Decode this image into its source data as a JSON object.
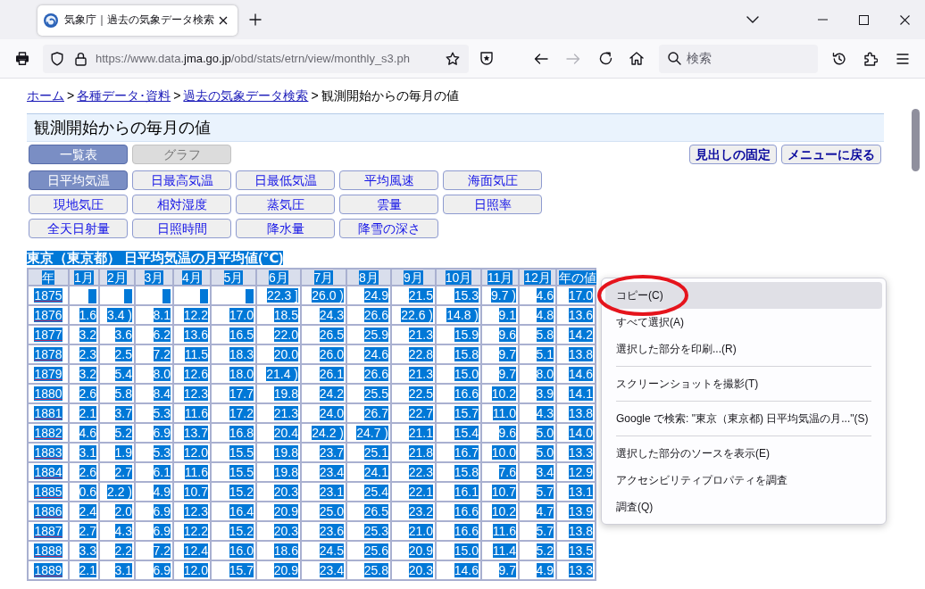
{
  "browser": {
    "tabs": [
      {
        "title": "気象庁｜過去の気象データ検索",
        "selected": true
      }
    ],
    "address": {
      "host_prefix": "https://www.data.",
      "domain": "jma.go.jp",
      "path": "/obd/stats/etrn/view/monthly_s3.ph"
    },
    "navigation": [
      {
        "kind": "back",
        "disabled": false
      },
      {
        "kind": "forward",
        "disabled": true
      }
    ],
    "search": {
      "placeholder": "検索"
    }
  },
  "breadcrumb": [
    {
      "kind": "link",
      "text": "ホーム"
    },
    {
      "kind": "separator",
      "text": ">"
    },
    {
      "kind": "link",
      "text": "各種データ･資料"
    },
    {
      "kind": "separator",
      "text": ">"
    },
    {
      "kind": "link",
      "text": "過去の気象データ検索"
    },
    {
      "kind": "separator",
      "text": ">"
    },
    {
      "kind": "current",
      "text": "観測開始からの毎月の値"
    }
  ],
  "page_title": "観測開始からの毎月の値",
  "view_buttons": [
    {
      "label": "一覧表",
      "selected": true,
      "disabled": false
    },
    {
      "label": "グラフ",
      "selected": false,
      "disabled": true
    }
  ],
  "action_buttons": [
    "見出しの固定",
    "メニューに戻る"
  ],
  "element_buttons": [
    {
      "label": "日平均気温",
      "selected": true
    },
    {
      "label": "日最高気温",
      "selected": false
    },
    {
      "label": "日最低気温",
      "selected": false
    },
    {
      "label": "平均風速",
      "selected": false
    },
    {
      "label": "海面気圧",
      "selected": false
    },
    {
      "label": "現地気圧",
      "selected": false
    },
    {
      "label": "相対湿度",
      "selected": false
    },
    {
      "label": "蒸気圧",
      "selected": false
    },
    {
      "label": "雲量",
      "selected": false
    },
    {
      "label": "日照率",
      "selected": false
    },
    {
      "label": "全天日射量",
      "selected": false
    },
    {
      "label": "日照時間",
      "selected": false
    },
    {
      "label": "降水量",
      "selected": false
    },
    {
      "label": "降雪の深さ",
      "selected": false
    }
  ],
  "table": {
    "caption": "東京（東京都） 日平均気温の月平均値(℃)",
    "highlighted": true,
    "columns": [
      "年",
      "1月",
      "2月",
      "3月",
      "4月",
      "5月",
      "6月",
      "7月",
      "8月",
      "9月",
      "10月",
      "11月",
      "12月",
      "年の値"
    ],
    "rows": [
      {
        "year": "1875",
        "gaps": [
          {
            "highlighted": true
          },
          {
            "highlighted": true
          },
          {
            "highlighted": true
          },
          {
            "highlighted": true
          },
          {
            "highlighted": true
          }
        ],
        "values": [
          "22.3 ]",
          "26.0 )",
          "24.9",
          "21.5",
          "15.3",
          "9.7 )",
          "4.6",
          "17.0"
        ]
      },
      {
        "year": "1876",
        "values": [
          "1.6",
          "3.4 )",
          "8.1",
          "12.2",
          "17.0",
          "18.5",
          "24.3",
          "26.6",
          "22.6 )",
          "14.8 )",
          "9.1",
          "4.8",
          "13.6"
        ]
      },
      {
        "year": "1877",
        "values": [
          "3.2",
          "3.6",
          "6.2",
          "13.6",
          "16.5",
          "22.0",
          "26.5",
          "25.9",
          "21.3",
          "15.9",
          "9.6",
          "5.8",
          "14.2"
        ]
      },
      {
        "year": "1878",
        "values": [
          "2.3",
          "2.5",
          "7.2",
          "11.5",
          "18.3",
          "20.0",
          "26.0",
          "24.6",
          "22.8",
          "15.8",
          "9.7",
          "5.1",
          "13.8"
        ]
      },
      {
        "year": "1879",
        "values": [
          "3.2",
          "5.4",
          "8.0",
          "12.6",
          "18.0",
          "21.4 )",
          "26.1",
          "26.6",
          "21.3",
          "15.0",
          "9.7",
          "8.0",
          "14.6"
        ]
      },
      {
        "year": "1880",
        "values": [
          "2.6",
          "5.8",
          "8.4",
          "12.3",
          "17.7",
          "19.8",
          "24.2",
          "25.5",
          "22.5",
          "16.6",
          "10.2",
          "3.9",
          "14.1"
        ]
      },
      {
        "year": "1881",
        "values": [
          "2.1",
          "3.7",
          "5.3",
          "11.6",
          "17.2",
          "21.3",
          "24.0",
          "26.7",
          "22.7",
          "15.7",
          "11.0",
          "4.3",
          "13.8"
        ]
      },
      {
        "year": "1882",
        "values": [
          "4.6",
          "5.2",
          "6.9",
          "13.7",
          "16.8",
          "20.4",
          "24.2 )",
          "24.7 )",
          "21.1",
          "15.4",
          "9.6",
          "5.0",
          "14.0"
        ]
      },
      {
        "year": "1883",
        "values": [
          "3.1",
          "1.9",
          "5.3",
          "12.0",
          "15.5",
          "19.8",
          "23.7",
          "25.1",
          "21.8",
          "16.7",
          "10.0",
          "5.0",
          "13.3"
        ]
      },
      {
        "year": "1884",
        "values": [
          "2.6",
          "2.7",
          "6.1",
          "11.6",
          "15.5",
          "19.8",
          "23.4",
          "24.1",
          "22.3",
          "15.8",
          "7.6",
          "3.4",
          "12.9"
        ]
      },
      {
        "year": "1885",
        "values": [
          "0.6",
          "2.2 )",
          "4.9",
          "10.7",
          "15.2",
          "20.3",
          "23.1",
          "25.4",
          "22.1",
          "16.1",
          "10.7",
          "5.7",
          "13.1"
        ]
      },
      {
        "year": "1886",
        "values": [
          "2.4",
          "2.0",
          "6.9",
          "12.3",
          "16.4",
          "20.9",
          "25.0",
          "26.5",
          "23.2",
          "16.6",
          "10.2",
          "4.7",
          "13.9"
        ]
      },
      {
        "year": "1887",
        "values": [
          "2.7",
          "4.3",
          "6.9",
          "12.2",
          "15.2",
          "20.3",
          "23.6",
          "25.3",
          "21.0",
          "16.6",
          "11.6",
          "5.7",
          "13.8"
        ]
      },
      {
        "year": "1888",
        "values": [
          "3.3",
          "2.2",
          "7.2",
          "12.4",
          "16.0",
          "18.6",
          "24.5",
          "25.6",
          "20.9",
          "15.0",
          "11.4",
          "5.2",
          "13.5"
        ]
      },
      {
        "year": "1889",
        "values": [
          "2.1",
          "3.1",
          "6.9",
          "12.0",
          "15.7",
          "20.9",
          "23.4",
          "25.8",
          "20.3",
          "14.6",
          "9.7",
          "4.9",
          "13.3"
        ]
      }
    ]
  },
  "context_menu": {
    "items": [
      {
        "kind": "item",
        "label": "コピー(C)",
        "hovered": true,
        "circled": true
      },
      {
        "kind": "item",
        "label": "すべて選択(A)",
        "hovered": false,
        "circled": false
      },
      {
        "kind": "item",
        "label": "選択した部分を印刷...(R)",
        "hovered": false,
        "circled": false
      },
      {
        "kind": "separator"
      },
      {
        "kind": "item",
        "label": "スクリーンショットを撮影(T)",
        "hovered": false,
        "circled": false
      },
      {
        "kind": "separator"
      },
      {
        "kind": "item",
        "label": "Google で検索: \"東京（東京都) 日平均気温の月...\"(S)",
        "hovered": false,
        "circled": false
      },
      {
        "kind": "separator"
      },
      {
        "kind": "item",
        "label": "選択した部分のソースを表示(E)",
        "hovered": false,
        "circled": false
      },
      {
        "kind": "item",
        "label": "アクセシビリティプロパティを調査",
        "hovered": false,
        "circled": false
      },
      {
        "kind": "item",
        "label": "調査(Q)",
        "hovered": false,
        "circled": false
      }
    ]
  }
}
